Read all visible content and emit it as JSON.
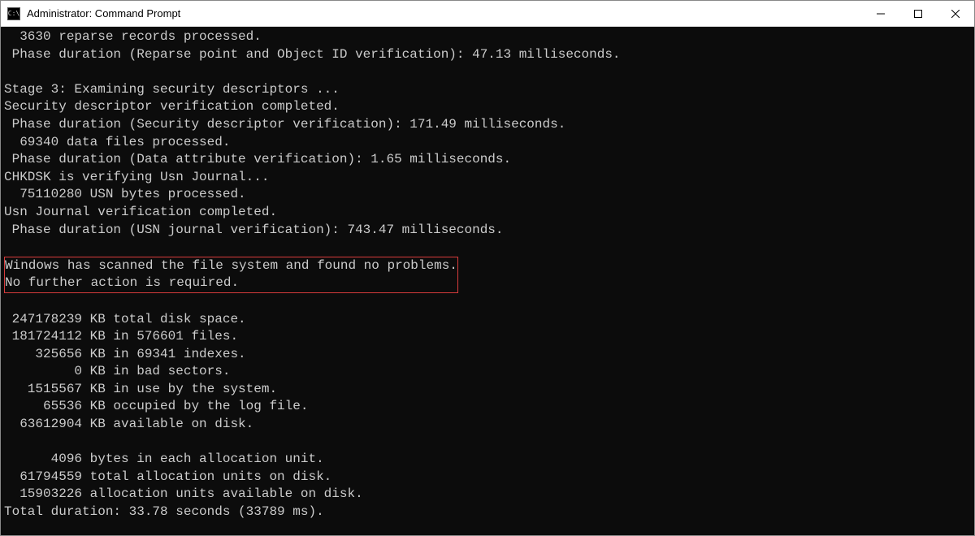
{
  "window": {
    "title": "Administrator: Command Prompt"
  },
  "terminal": {
    "lines": [
      "  3630 reparse records processed.",
      " Phase duration (Reparse point and Object ID verification): 47.13 milliseconds.",
      "",
      "Stage 3: Examining security descriptors ...",
      "Security descriptor verification completed.",
      " Phase duration (Security descriptor verification): 171.49 milliseconds.",
      "  69340 data files processed.",
      " Phase duration (Data attribute verification): 1.65 milliseconds.",
      "CHKDSK is verifying Usn Journal...",
      "  75110280 USN bytes processed.",
      "Usn Journal verification completed.",
      " Phase duration (USN journal verification): 743.47 milliseconds.",
      "",
      "",
      "",
      " 247178239 KB total disk space.",
      " 181724112 KB in 576601 files.",
      "    325656 KB in 69341 indexes.",
      "         0 KB in bad sectors.",
      "   1515567 KB in use by the system.",
      "     65536 KB occupied by the log file.",
      "  63612904 KB available on disk.",
      "",
      "      4096 bytes in each allocation unit.",
      "  61794559 total allocation units on disk.",
      "  15903226 allocation units available on disk.",
      "Total duration: 33.78 seconds (33789 ms)."
    ],
    "highlight": {
      "line1": "Windows has scanned the file system and found no problems.",
      "line2": "No further action is required.                            "
    }
  }
}
